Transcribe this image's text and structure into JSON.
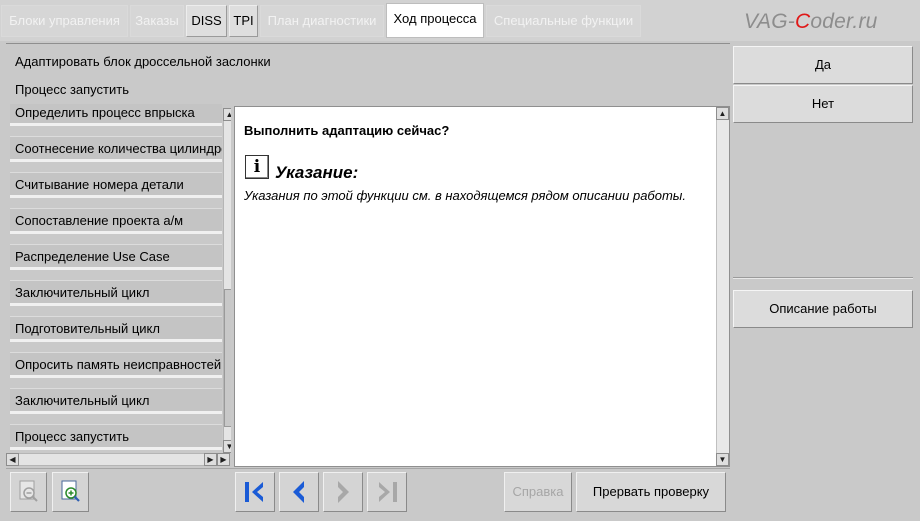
{
  "tabs": [
    {
      "label": "Блоки управления",
      "state": "dim"
    },
    {
      "label": "Заказы",
      "state": "dim"
    },
    {
      "label": "DISS",
      "state": "enabled"
    },
    {
      "label": "TPI",
      "state": "enabled"
    },
    {
      "label": "План диагностики",
      "state": "dim"
    },
    {
      "label": "Ход процесса",
      "state": "selected"
    },
    {
      "label": "Специальные функции",
      "state": "dim"
    }
  ],
  "logo": {
    "part1": "VAG-",
    "part2": "C",
    "part3": "oder.ru"
  },
  "header": {
    "line1": "Адаптировать блок дроссельной заслонки",
    "line2": "Процесс запустить"
  },
  "steps": [
    "Определить процесс впрыска",
    "Соотнесение количества цилиндров",
    "Считывание номера детали",
    "Сопоставление проекта а/м",
    "Распределение Use Case",
    "Заключительный цикл",
    "Подготовительный цикл",
    "Опросить память неисправностей",
    "Заключительный цикл",
    "Процесс запустить"
  ],
  "content": {
    "question": "Выполнить адаптацию сейчас?",
    "info_icon_glyph": "i",
    "hint_title": "Указание:",
    "hint_text": "Указания по этой функции см. в находящемся рядом описании работы."
  },
  "right_buttons": {
    "yes": "Да",
    "no": "Нет",
    "description": "Описание работы"
  },
  "bottom": {
    "help": "Справка",
    "abort": "Прервать проверку"
  },
  "colors": {
    "nav_blue": "#1a5bd6",
    "nav_disabled": "#a8a8a8",
    "logo_red": "#e01818"
  }
}
